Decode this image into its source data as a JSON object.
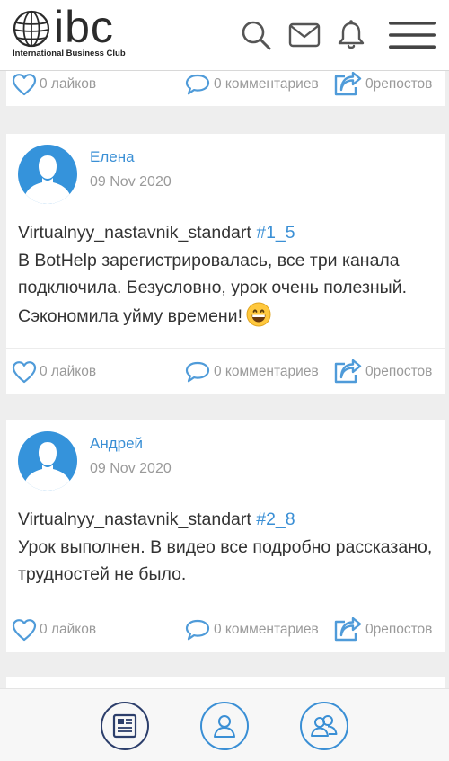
{
  "header": {
    "logo_text": "ibc",
    "logo_tagline": "International Business Club",
    "icons": [
      "search-icon",
      "mail-icon",
      "bell-icon",
      "hamburger-menu-icon"
    ]
  },
  "posts": [
    {
      "actions": {
        "likes": "0 лайков",
        "comments": "0 комментариев",
        "shares": "0репостов"
      }
    },
    {
      "author": "Елена",
      "date": "09 Nov 2020",
      "course": "Virtualnyy_nastavnik_standart",
      "tag": "#1_5",
      "body": "В BotHelp зарегистрировалась, все три канала подключила. Безусловно, урок очень полезный. Сэкономила уйму времени!",
      "emoji": "grinning-face",
      "actions": {
        "likes": "0 лайков",
        "comments": "0 комментариев",
        "shares": "0репостов"
      }
    },
    {
      "author": "Андрей",
      "date": "09 Nov 2020",
      "course": "Virtualnyy_nastavnik_standart",
      "tag": "#2_8",
      "body": "Урок выполнен. В видео все подробно рассказано, трудностей не было.",
      "actions": {
        "likes": "0 лайков",
        "comments": "0 комментариев",
        "shares": "0репостов"
      }
    }
  ],
  "bottom_nav": {
    "items": [
      "news-feed-icon",
      "profile-icon",
      "friends-icon"
    ],
    "active": "news-feed-icon"
  },
  "colors": {
    "accent": "#3a8fd5",
    "avatar": "#3593db",
    "muted_text": "#9a9a9a",
    "body_text": "#333333",
    "background": "#eeeeee",
    "nav_active": "#2c3e6b"
  }
}
